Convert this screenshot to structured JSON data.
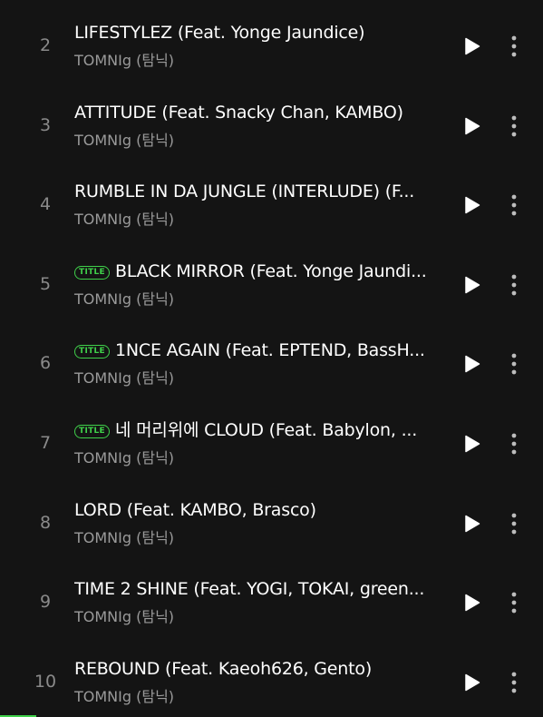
{
  "tracks": [
    {
      "number": "2",
      "title": "LIFESTYLEZ (Feat. Yonge Jaundice)",
      "artist": "TOMNIg (탐닉)",
      "is_title": false
    },
    {
      "number": "3",
      "title": "ATTITUDE (Feat. Snacky Chan, KAMBO)",
      "artist": "TOMNIg (탐닉)",
      "is_title": false
    },
    {
      "number": "4",
      "title": "RUMBLE IN DA JUNGLE (INTERLUDE) (F...",
      "artist": "TOMNIg (탐닉)",
      "is_title": false
    },
    {
      "number": "5",
      "title": "BLACK MIRROR (Feat. Yonge Jaundi...",
      "artist": "TOMNIg (탐닉)",
      "is_title": true
    },
    {
      "number": "6",
      "title": "1NCE AGAIN (Feat. EPTEND, BassH...",
      "artist": "TOMNIg (탐닉)",
      "is_title": true
    },
    {
      "number": "7",
      "title": "네 머리위에 CLOUD (Feat. Babylon, ...",
      "artist": "TOMNIg (탐닉)",
      "is_title": true
    },
    {
      "number": "8",
      "title": "LORD (Feat. KAMBO, Brasco)",
      "artist": "TOMNIg (탐닉)",
      "is_title": false
    },
    {
      "number": "9",
      "title": "TIME 2 SHINE (Feat. YOGI, TOKAI, green...",
      "artist": "TOMNIg (탐닉)",
      "is_title": false
    },
    {
      "number": "10",
      "title": "REBOUND (Feat. Kaeoh626, Gento)",
      "artist": "TOMNIg (탐닉)",
      "is_title": false
    }
  ],
  "badge_label": "TITLE",
  "icons": {
    "play": "play-icon",
    "more": "more-vertical-icon"
  },
  "colors": {
    "background": "#141414",
    "title_text": "#ffffff",
    "secondary_text": "#9a9a9a",
    "track_number": "#8a8a8a",
    "accent": "#3fd04a"
  }
}
